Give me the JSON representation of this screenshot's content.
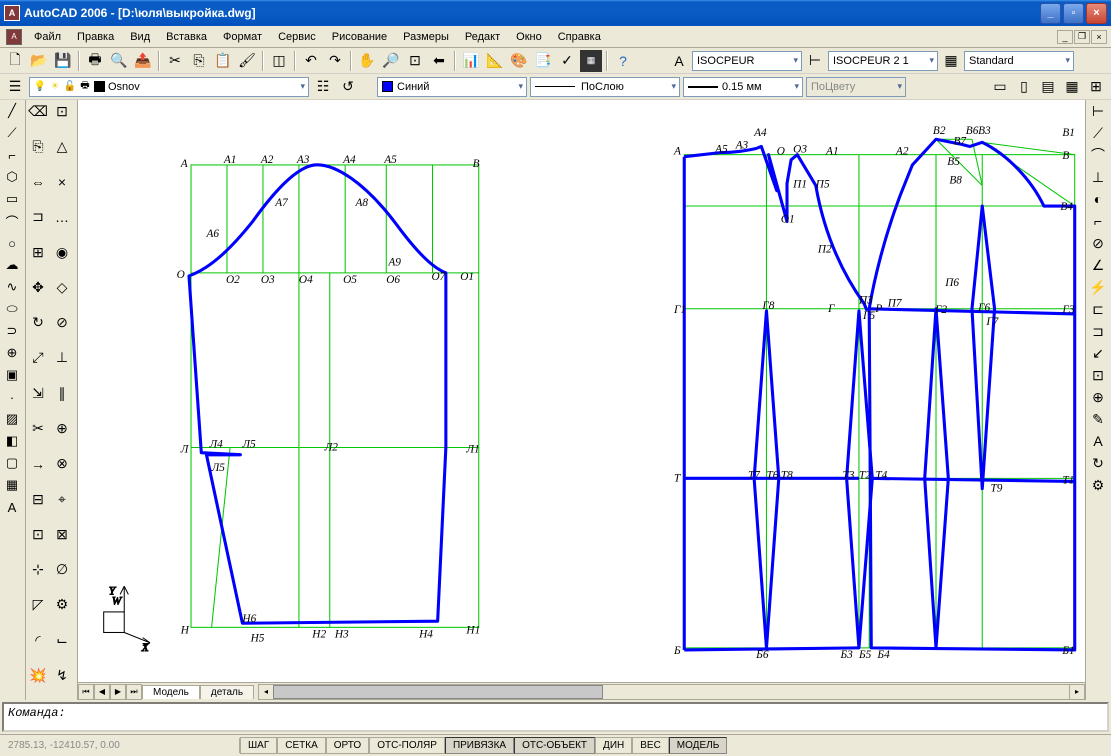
{
  "title": "AutoCAD 2006 - [D:\\юля\\выкройка.dwg]",
  "menu": [
    "Файл",
    "Правка",
    "Вид",
    "Вставка",
    "Формат",
    "Сервис",
    "Рисование",
    "Размеры",
    "Редакт",
    "Окно",
    "Справка"
  ],
  "style_combos": {
    "text_style": "ISOCPEUR",
    "dim_style": "ISOCPEUR 2 1",
    "table_style": "Standard"
  },
  "layer": {
    "name": "Osnov"
  },
  "props": {
    "color_label": "Синий",
    "linetype": "ПоСлою",
    "lineweight": "0.15 мм",
    "plot_style": "ПоЦвету"
  },
  "tabs": {
    "model": "Модель",
    "layout": "деталь"
  },
  "command_prompt": "Команда:",
  "coords": "2785.13, -12410.57, 0.00",
  "status_buttons": [
    "ШАГ",
    "СЕТКА",
    "ОРТО",
    "ОТС-ПОЛЯР",
    "ПРИВЯЗКА",
    "ОТС-ОБЪЕКТ",
    "ДИН",
    "ВЕС",
    "МОДЕЛЬ"
  ],
  "status_active": [
    false,
    false,
    false,
    false,
    true,
    true,
    false,
    false,
    true
  ],
  "left_labels": {
    "A": "А",
    "B": "В",
    "O": "О",
    "O1": "О1",
    "N": "Н",
    "N1": "Н1",
    "L": "Л",
    "L1": "Л1",
    "A1": "А1",
    "A2": "А2",
    "A3": "А3",
    "A4": "А4",
    "A5": "А5",
    "A6": "А6",
    "A7": "А7",
    "A8": "А8",
    "A9": "А9",
    "O2": "О2",
    "O3": "О3",
    "O4": "О4",
    "O5": "О5",
    "O6": "О6",
    "O7": "О7",
    "L2": "Л2",
    "L4": "Л4",
    "L5": "Л5",
    "L5b": "Л5",
    "N2": "Н2",
    "N3": "Н3",
    "N4": "Н4",
    "N5": "Н5",
    "N6": "Н6"
  },
  "right_labels": {
    "A": "А",
    "A1": "А1",
    "A2": "А2",
    "A3": "А3",
    "A4": "А4",
    "A5": "А5",
    "B": "В",
    "B1": "В1",
    "B2": "В2",
    "B3": "В3",
    "B4": "В4",
    "B5": "В5",
    "B6": "В6",
    "B7": "В7",
    "B8": "В8",
    "O": "О",
    "O1": "О1",
    "O3": "О3",
    "P": "Р",
    "P1": "П1",
    "P2": "П2",
    "P3": "П3",
    "P5": "П5",
    "P6": "П6",
    "P7": "П7",
    "G": "Г",
    "G1": "Г1",
    "G2": "Г2",
    "G3": "Г3",
    "G5": "Г5",
    "G6": "Г6",
    "G7": "Г7",
    "G8": "Г8",
    "T": "Т",
    "T1": "Т1",
    "T2": "Т2",
    "T3": "Т3",
    "T4": "Т4",
    "T6": "Т6",
    "T7": "Т7",
    "T8": "Т8",
    "T9": "Т9",
    "Bt": "Б",
    "Bt1": "Б1",
    "Bt3": "Б3",
    "Bt4": "Б4",
    "Bt5": "Б5",
    "Bt6": "Б6"
  }
}
